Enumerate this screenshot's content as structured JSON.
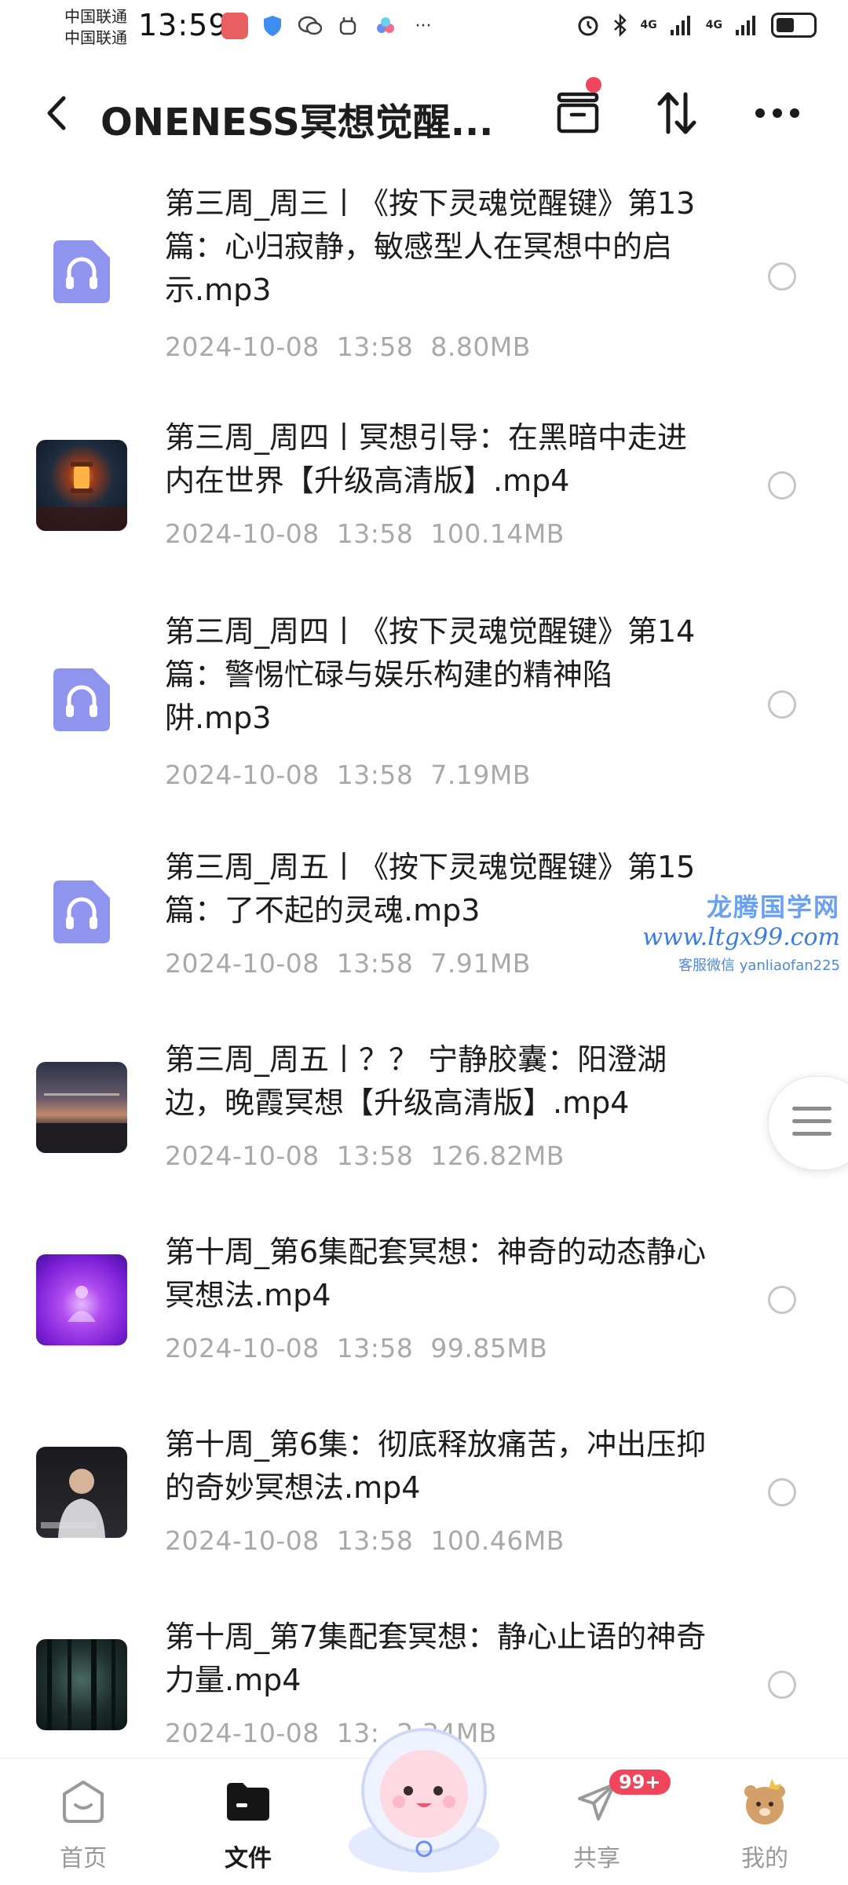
{
  "status_bar": {
    "carrier_1": "中国联通",
    "carrier_2": "中国联通",
    "time": "13:59",
    "network_1": "4G",
    "network_2": "4G"
  },
  "header": {
    "title": "ONENESS冥想觉醒..."
  },
  "files": [
    {
      "name": "第三周_周三丨《按下灵魂觉醒键》第13篇：心归寂静，敏感型人在冥想中的启示.mp3",
      "date": "2024-10-08",
      "time": "13:58",
      "size": "8.80MB",
      "type": "audio"
    },
    {
      "name": "第三周_周四丨冥想引导：在黑暗中走进内在世界【升级高清版】.mp4",
      "date": "2024-10-08",
      "time": "13:58",
      "size": "100.14MB",
      "type": "video",
      "thumb": "lantern"
    },
    {
      "name": "第三周_周四丨《按下灵魂觉醒键》第14篇：警惕忙碌与娱乐构建的精神陷阱.mp3",
      "date": "2024-10-08",
      "time": "13:58",
      "size": "7.19MB",
      "type": "audio"
    },
    {
      "name": "第三周_周五丨《按下灵魂觉醒键》第15篇：了不起的灵魂.mp3",
      "date": "2024-10-08",
      "time": "13:58",
      "size": "7.91MB",
      "type": "audio"
    },
    {
      "name": "第三周_周五丨？？ 宁静胶囊：阳澄湖边，晚霞冥想【升级高清版】.mp4",
      "date": "2024-10-08",
      "time": "13:58",
      "size": "126.82MB",
      "type": "video",
      "thumb": "sunset"
    },
    {
      "name": "第十周_第6集配套冥想：神奇的动态静心冥想法.mp4",
      "date": "2024-10-08",
      "time": "13:58",
      "size": "99.85MB",
      "type": "video",
      "thumb": "purple"
    },
    {
      "name": "第十周_第6集：彻底释放痛苦，冲出压抑的奇妙冥想法.mp4",
      "date": "2024-10-08",
      "time": "13:58",
      "size": "100.46MB",
      "type": "video",
      "thumb": "speaker"
    },
    {
      "name": "第十周_第7集配套冥想：静心止语的神奇力量.mp4",
      "date": "2024-10-08",
      "time": "13:",
      "size": "2.34MB",
      "type": "video",
      "thumb": "forest"
    }
  ],
  "watermark": {
    "line1": "龙腾国学网",
    "line2": "www.ltgx99.com",
    "line3": "客服微信 yanliaofan225"
  },
  "nav": {
    "home": "首页",
    "files": "文件",
    "share": "共享",
    "share_badge": "99+",
    "me": "我的"
  },
  "colors": {
    "audio_icon": "#8f95ef",
    "badge": "#f2455b",
    "meta_text": "#a9a9a9"
  }
}
